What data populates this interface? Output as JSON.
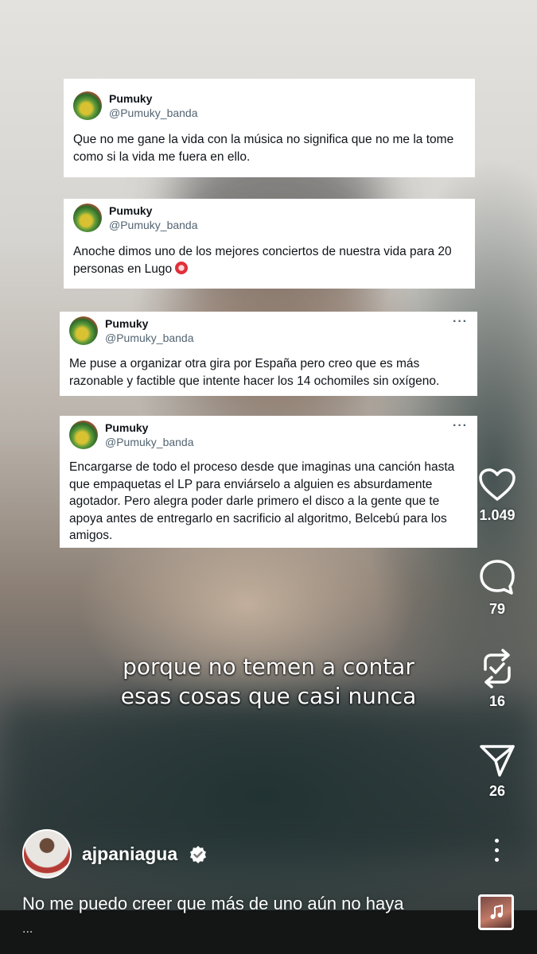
{
  "tweets": [
    {
      "name": "Pumuky",
      "handle": "@Pumuky_banda",
      "text": "Que no me gane la vida con la música no significa que no me la tome como si la vida me fuera en ello.",
      "more": ""
    },
    {
      "name": "Pumuky",
      "handle": "@Pumuky_banda",
      "text": "Anoche dimos uno de los mejores conciertos de nuestra vida para 20 personas en Lugo",
      "more": ""
    },
    {
      "name": "Pumuky",
      "handle": "@Pumuky_banda",
      "text": "Me puse a organizar otra gira por España pero creo que es más razonable y factible que intente hacer los 14 ochomiles sin oxígeno.",
      "more": "···"
    },
    {
      "name": "Pumuky",
      "handle": "@Pumuky_banda",
      "text": "Encargarse de todo el proceso desde que imaginas una canción hasta que empaquetas el LP para enviárselo a alguien es absurdamente agotador. Pero alegra poder darle primero el disco a la gente que te apoya antes de entregarlo en sacrificio al algoritmo, Belcebú para los amigos.",
      "more": "···"
    }
  ],
  "subtitle": {
    "line1": "porque no temen a contar",
    "line2": "esas cosas que casi nunca"
  },
  "actions": {
    "likes": "1.049",
    "comments": "79",
    "reposts": "16",
    "shares": "26"
  },
  "icons": {
    "like": "heart-icon",
    "comment": "comment-bubble-icon",
    "repost": "repost-icon",
    "share": "send-icon",
    "more": "more-vertical-icon",
    "verified": "verified-badge-icon",
    "music": "music-note-icon"
  },
  "creator": {
    "username": "ajpaniagua",
    "caption": "No me puedo creer que más de uno aún no haya",
    "caption_more": "..."
  }
}
